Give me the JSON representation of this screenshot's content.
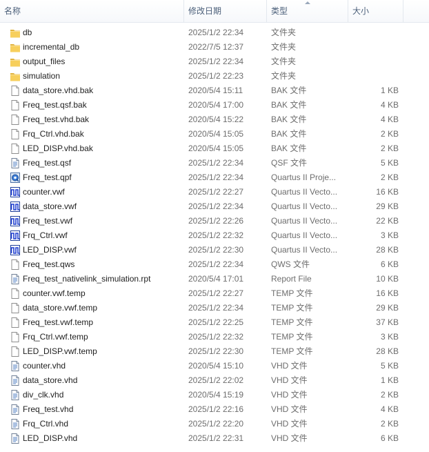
{
  "header": {
    "name": "名称",
    "date": "修改日期",
    "type": "类型",
    "size": "大小"
  },
  "files": [
    {
      "name": "db",
      "date": "2025/1/2 22:34",
      "type": "文件夹",
      "size": "",
      "icon": "folder-icon"
    },
    {
      "name": "incremental_db",
      "date": "2022/7/5 12:37",
      "type": "文件夹",
      "size": "",
      "icon": "folder-icon"
    },
    {
      "name": "output_files",
      "date": "2025/1/2 22:34",
      "type": "文件夹",
      "size": "",
      "icon": "folder-icon"
    },
    {
      "name": "simulation",
      "date": "2025/1/2 22:23",
      "type": "文件夹",
      "size": "",
      "icon": "folder-icon"
    },
    {
      "name": "data_store.vhd.bak",
      "date": "2020/5/4 15:11",
      "type": "BAK 文件",
      "size": "1 KB",
      "icon": "blank-file-icon"
    },
    {
      "name": "Freq_test.qsf.bak",
      "date": "2020/5/4 17:00",
      "type": "BAK 文件",
      "size": "4 KB",
      "icon": "blank-file-icon"
    },
    {
      "name": "Freq_test.vhd.bak",
      "date": "2020/5/4 15:22",
      "type": "BAK 文件",
      "size": "4 KB",
      "icon": "blank-file-icon"
    },
    {
      "name": "Frq_Ctrl.vhd.bak",
      "date": "2020/5/4 15:05",
      "type": "BAK 文件",
      "size": "2 KB",
      "icon": "blank-file-icon"
    },
    {
      "name": "LED_DISP.vhd.bak",
      "date": "2020/5/4 15:05",
      "type": "BAK 文件",
      "size": "2 KB",
      "icon": "blank-file-icon"
    },
    {
      "name": "Freq_test.qsf",
      "date": "2025/1/2 22:34",
      "type": "QSF 文件",
      "size": "5 KB",
      "icon": "text-file-icon"
    },
    {
      "name": "Freq_test.qpf",
      "date": "2025/1/2 22:34",
      "type": "Quartus II Proje...",
      "size": "2 KB",
      "icon": "quartus-project-icon"
    },
    {
      "name": "counter.vwf",
      "date": "2025/1/2 22:27",
      "type": "Quartus II Vecto...",
      "size": "16 KB",
      "icon": "waveform-icon"
    },
    {
      "name": "data_store.vwf",
      "date": "2025/1/2 22:34",
      "type": "Quartus II Vecto...",
      "size": "29 KB",
      "icon": "waveform-icon"
    },
    {
      "name": "Freq_test.vwf",
      "date": "2025/1/2 22:26",
      "type": "Quartus II Vecto...",
      "size": "22 KB",
      "icon": "waveform-icon"
    },
    {
      "name": "Frq_Ctrl.vwf",
      "date": "2025/1/2 22:32",
      "type": "Quartus II Vecto...",
      "size": "3 KB",
      "icon": "waveform-icon"
    },
    {
      "name": "LED_DISP.vwf",
      "date": "2025/1/2 22:30",
      "type": "Quartus II Vecto...",
      "size": "28 KB",
      "icon": "waveform-icon"
    },
    {
      "name": "Freq_test.qws",
      "date": "2025/1/2 22:34",
      "type": "QWS 文件",
      "size": "6 KB",
      "icon": "blank-file-icon"
    },
    {
      "name": "Freq_test_nativelink_simulation.rpt",
      "date": "2020/5/4 17:01",
      "type": "Report File",
      "size": "10 KB",
      "icon": "text-file-icon"
    },
    {
      "name": "counter.vwf.temp",
      "date": "2025/1/2 22:27",
      "type": "TEMP 文件",
      "size": "16 KB",
      "icon": "blank-file-icon"
    },
    {
      "name": "data_store.vwf.temp",
      "date": "2025/1/2 22:34",
      "type": "TEMP 文件",
      "size": "29 KB",
      "icon": "blank-file-icon"
    },
    {
      "name": "Freq_test.vwf.temp",
      "date": "2025/1/2 22:25",
      "type": "TEMP 文件",
      "size": "37 KB",
      "icon": "blank-file-icon"
    },
    {
      "name": "Frq_Ctrl.vwf.temp",
      "date": "2025/1/2 22:32",
      "type": "TEMP 文件",
      "size": "3 KB",
      "icon": "blank-file-icon"
    },
    {
      "name": "LED_DISP.vwf.temp",
      "date": "2025/1/2 22:30",
      "type": "TEMP 文件",
      "size": "28 KB",
      "icon": "blank-file-icon"
    },
    {
      "name": "counter.vhd",
      "date": "2020/5/4 15:10",
      "type": "VHD 文件",
      "size": "5 KB",
      "icon": "text-file-icon"
    },
    {
      "name": "data_store.vhd",
      "date": "2025/1/2 22:02",
      "type": "VHD 文件",
      "size": "1 KB",
      "icon": "text-file-icon"
    },
    {
      "name": "div_clk.vhd",
      "date": "2020/5/4 15:19",
      "type": "VHD 文件",
      "size": "2 KB",
      "icon": "text-file-icon"
    },
    {
      "name": "Freq_test.vhd",
      "date": "2025/1/2 22:16",
      "type": "VHD 文件",
      "size": "4 KB",
      "icon": "text-file-icon"
    },
    {
      "name": "Frq_Ctrl.vhd",
      "date": "2025/1/2 22:20",
      "type": "VHD 文件",
      "size": "2 KB",
      "icon": "text-file-icon"
    },
    {
      "name": "LED_DISP.vhd",
      "date": "2025/1/2 22:31",
      "type": "VHD 文件",
      "size": "6 KB",
      "icon": "text-file-icon"
    }
  ]
}
